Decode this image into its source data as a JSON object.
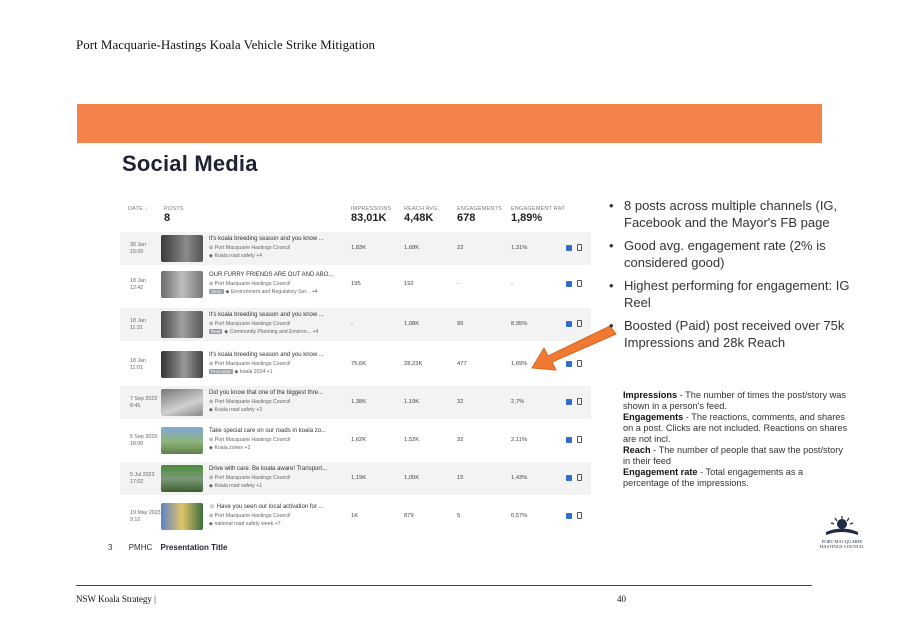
{
  "document": {
    "header": "Port Macquarie-Hastings Koala Vehicle Strike Mitigation",
    "footer_left": "NSW Koala Strategy |",
    "page_number": "40"
  },
  "slide": {
    "title": "Social Media",
    "footer_number": "3",
    "footer_org": "PMHC",
    "footer_title": "Presentation Title",
    "accent_color": "#f4824a",
    "logo_text_line1": "PORT MACQUARIE",
    "logo_text_line2": "HASTINGS COUNCIL"
  },
  "table": {
    "headers": {
      "date": "DATE ↓",
      "posts": "POSTS",
      "impressions": "IMPRESSIONS",
      "reach": "REACH AVG.",
      "engagements": "ENGAGEMENTS",
      "engagement_rate": "ENGAGEMENT RAT"
    },
    "totals": {
      "posts": "8",
      "impressions": "83,01K",
      "reach": "4,48K",
      "engagements": "678",
      "engagement_rate": "1,89%"
    },
    "rows": [
      {
        "date": "30 Jan\n15:09",
        "title": "It's koala breeding season and you know ...",
        "account": "Port Macquarie Hastings Council",
        "badge": "",
        "tags": "Koala road safety +4",
        "impressions": "1,83K",
        "reach": "1,68K",
        "engagements": "22",
        "rate": "1,31%"
      },
      {
        "date": "18 Jan\n12:42",
        "title": "OUR FURRY FRIENDS ARE OUT AND ABO...",
        "account": "Port Macquarie Hastings Council",
        "badge": "Story",
        "tags": "Environment and Regulatory Ser... +4",
        "impressions": "195",
        "reach": "192",
        "engagements": "-",
        "rate": "-"
      },
      {
        "date": "18 Jan\n11:31",
        "title": "It's koala breeding season and you know ...",
        "account": "Port Macquarie Hastings Council",
        "badge": "Reel",
        "tags": "Community Planning and Environ... +4",
        "impressions": "-",
        "reach": "1,08K",
        "engagements": "95",
        "rate": "8,95%"
      },
      {
        "date": "18 Jan\n11:01",
        "title": "It's koala breeding season and you know ...",
        "account": "Port Macquarie Hastings Council",
        "badge": "Promoted",
        "tags": "koala 2024 +1",
        "impressions": "75,6K",
        "reach": "28,23K",
        "engagements": "477",
        "rate": "1,69%"
      },
      {
        "date": "7 Sep 2023\n8:45",
        "title": "Did you know that one of the biggest thre...",
        "account": "Port Macquarie Hastings Council",
        "badge": "",
        "tags": "Koala road safety +3",
        "impressions": "1,38K",
        "reach": "1,19K",
        "engagements": "32",
        "rate": "2,7%"
      },
      {
        "date": "5 Sep 2023\n18:00",
        "title": "Take special care on our roads in koala zo...",
        "account": "Port Macquarie Hastings Council",
        "badge": "",
        "tags": "Koala zones +2",
        "impressions": "1,62K",
        "reach": "1,52K",
        "engagements": "32",
        "rate": "2,11%"
      },
      {
        "date": "5 Jul 2023\n17:02",
        "title": "Drive with care. Be koala aware! Transport...",
        "account": "Port Macquarie Hastings Council",
        "badge": "",
        "tags": "Koala road safety +1",
        "impressions": "1,19K",
        "reach": "1,05K",
        "engagements": "15",
        "rate": "1,43%"
      },
      {
        "date": "19 May 2023\n9:10",
        "title": "Have you seen our local activation for ...",
        "account": "Port Macquarie Hastings Council",
        "badge": "",
        "tags": "national road safety week +7",
        "impressions": "1K",
        "reach": "879",
        "engagements": "5",
        "rate": "0,57%"
      }
    ]
  },
  "bullets": [
    "8 posts across multiple channels (IG, Facebook and the Mayor's FB page",
    "Good avg. engagement rate (2% is considered good)",
    "Highest performing for engagement: IG Reel",
    "Boosted (Paid) post received over 75k Impressions and 28k Reach"
  ],
  "definitions": [
    {
      "term": "Impressions",
      "text": " - The number of times the post/story was shown in a person's feed."
    },
    {
      "term": "Engagements",
      "text": " - The reactions, comments, and shares on a post. Clicks are not included. Reactions on shares are not incl."
    },
    {
      "term": "Reach",
      "text": " - The number of people that saw the post/story in their feed"
    },
    {
      "term": "Engagement rate",
      "text": " - Total engagements as a percentage of the impressions."
    }
  ]
}
